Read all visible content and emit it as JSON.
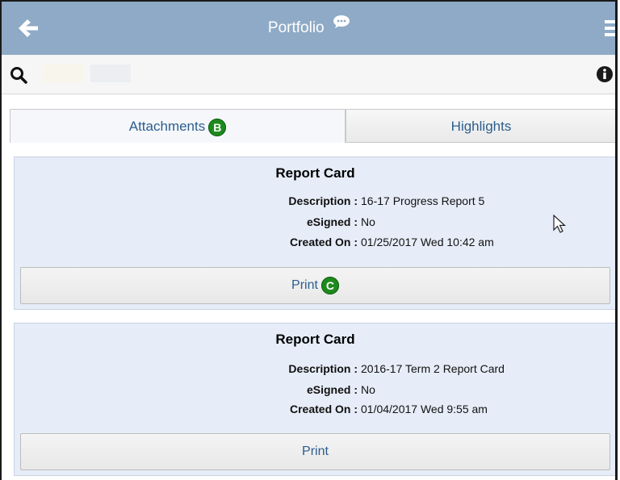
{
  "header": {
    "title": "Portfolio",
    "back_icon": "back-arrow-icon",
    "chat_icon": "speech-bubble-icon",
    "menu_icon": "hamburger-menu-icon"
  },
  "search": {
    "icon": "search-icon",
    "info_icon": "info-icon"
  },
  "tabs": [
    {
      "label": "Attachments",
      "active": true,
      "badge": "B"
    },
    {
      "label": "Highlights",
      "active": false
    }
  ],
  "cards": [
    {
      "title": "Report Card",
      "fields": [
        {
          "label": "Description :",
          "value": "16-17 Progress Report 5"
        },
        {
          "label": "eSigned :",
          "value": "No"
        },
        {
          "label": "Created On :",
          "value": "01/25/2017 Wed 10:42 am"
        }
      ],
      "button_label": "Print",
      "button_badge": "C"
    },
    {
      "title": "Report Card",
      "fields": [
        {
          "label": "Description :",
          "value": "2016-17 Term 2 Report Card"
        },
        {
          "label": "eSigned :",
          "value": "No"
        },
        {
          "label": "Created On :",
          "value": "01/04/2017 Wed 9:55 am"
        }
      ],
      "button_label": "Print"
    }
  ],
  "colors": {
    "header_bg": "#8eaac6",
    "card_bg": "#e6edf8",
    "link_blue": "#2c5e8f",
    "badge_green": "#1e8a1e"
  }
}
